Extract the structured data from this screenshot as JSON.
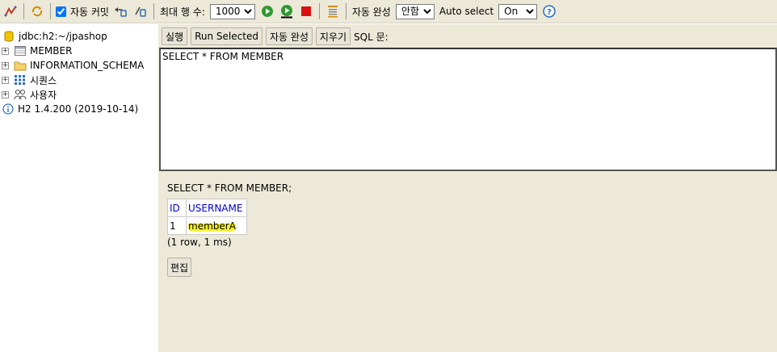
{
  "toolbar": {
    "autocommit_label": "자동 커밋",
    "autocommit_checked": true,
    "max_rows_label": "최대 행 수:",
    "max_rows_value": "1000",
    "autocomplete_label": "자동 완성",
    "autocomplete_value": "안함",
    "autoselect_label": "Auto select",
    "autoselect_value": "On",
    "help_icon": "?"
  },
  "tree": {
    "connection": "jdbc:h2:~/jpashop",
    "items": [
      {
        "label": "MEMBER",
        "icon": "table-icon"
      },
      {
        "label": "INFORMATION_SCHEMA",
        "icon": "folder-icon"
      },
      {
        "label": "시퀀스",
        "icon": "sequence-icon"
      },
      {
        "label": "사용자",
        "icon": "users-icon"
      }
    ],
    "version": "H2 1.4.200 (2019-10-14)"
  },
  "editor": {
    "buttons": {
      "run": "실행",
      "run_selected": "Run Selected",
      "autocomplete": "자동 완성",
      "clear": "지우기"
    },
    "sql_label": "SQL 문:",
    "sql_text": "SELECT * FROM MEMBER "
  },
  "result": {
    "sql": "SELECT * FROM MEMBER;",
    "columns": [
      "ID",
      "USERNAME"
    ],
    "rows": [
      [
        "1",
        "memberA"
      ]
    ],
    "stats": "(1 row, 1 ms)",
    "edit_button": "편집"
  },
  "colors": {
    "toolbar_bg": "#ece9d8",
    "header_link": "#0000cc",
    "highlight": "#f8f32b"
  }
}
